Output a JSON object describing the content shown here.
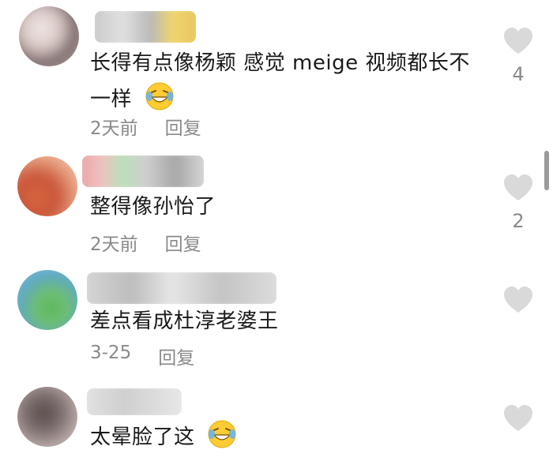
{
  "comments": [
    {
      "text_line1": "长得有点像杨颖 感觉 meige 视频都长不",
      "text_line2": "一样",
      "time": "2天前",
      "reply_label": "回复",
      "likes": "4",
      "emoji": "laughing-crying-emoji"
    },
    {
      "text_line1": "整得像孙怡了",
      "time": "2天前",
      "reply_label": "回复",
      "likes": "2"
    },
    {
      "text_line1": "差点看成杜淳老婆王",
      "time": "3-25",
      "reply_label": "回复",
      "likes": ""
    },
    {
      "text_line1": "太晕脸了这",
      "emoji": "laughing-crying-emoji"
    }
  ],
  "colors": {
    "text": "#1a1a1a",
    "meta": "#8a8a8a",
    "heart": "#d9d9d9"
  }
}
